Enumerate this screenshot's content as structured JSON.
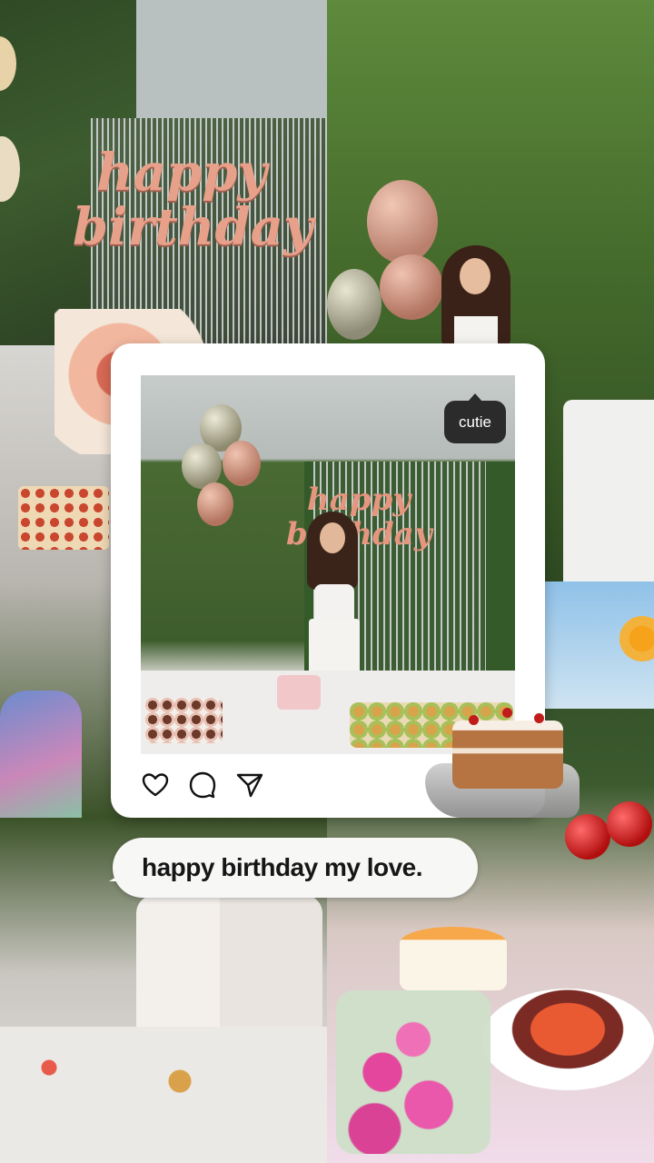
{
  "post": {
    "tag_label": "cutie",
    "caption": "happy birthday my love.",
    "actions": {
      "like_icon": "heart-icon",
      "comment_icon": "comment-bubble-icon",
      "share_icon": "paper-plane-icon"
    }
  },
  "background": {
    "banner_text": "happy birthday"
  },
  "colors": {
    "frame": "#ffffff",
    "tag_bg": "#2b2b2b",
    "caption_bg": "#f7f7f6",
    "banner": "#e7a08a"
  }
}
